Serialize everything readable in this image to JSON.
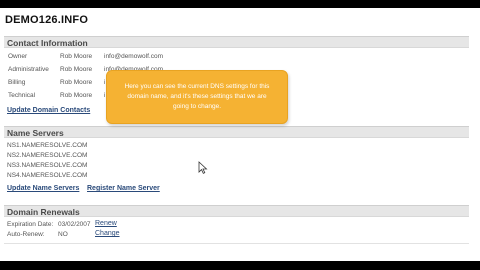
{
  "domain": "DEMO126.INFO",
  "contact": {
    "header": "Contact Information",
    "rows": [
      {
        "label": "Owner",
        "name": "Rob Moore",
        "email": "info@demowolf.com"
      },
      {
        "label": "Administrative",
        "name": "Rob Moore",
        "email": "info@demowolf.com"
      },
      {
        "label": "Billing",
        "name": "Rob Moore",
        "email": "i"
      },
      {
        "label": "Technical",
        "name": "Rob Moore",
        "email": "i"
      }
    ],
    "update_link": "Update Domain Contacts"
  },
  "name_servers": {
    "header": "Name Servers",
    "items": [
      "NS1.NAMERESOLVE.COM",
      "NS2.NAMERESOLVE.COM",
      "NS3.NAMERESOLVE.COM",
      "NS4.NAMERESOLVE.COM"
    ],
    "update_link": "Update Name Servers",
    "register_link": "Register Name Server"
  },
  "renewals": {
    "header": "Domain Renewals",
    "expiration_label": "Expiration Date:",
    "expiration_value": "03/02/2007",
    "renew_link": "Renew",
    "autorenew_label": "Auto-Renew:",
    "autorenew_value": "NO",
    "change_link": "Change"
  },
  "callout": {
    "text": "Here you can see the current DNS settings for this domain name, and it's these settings that we are going to change."
  },
  "colors": {
    "callout_bg": "#f5b233",
    "link": "#2a4a7a",
    "header_bg": "#e6e6e6"
  }
}
